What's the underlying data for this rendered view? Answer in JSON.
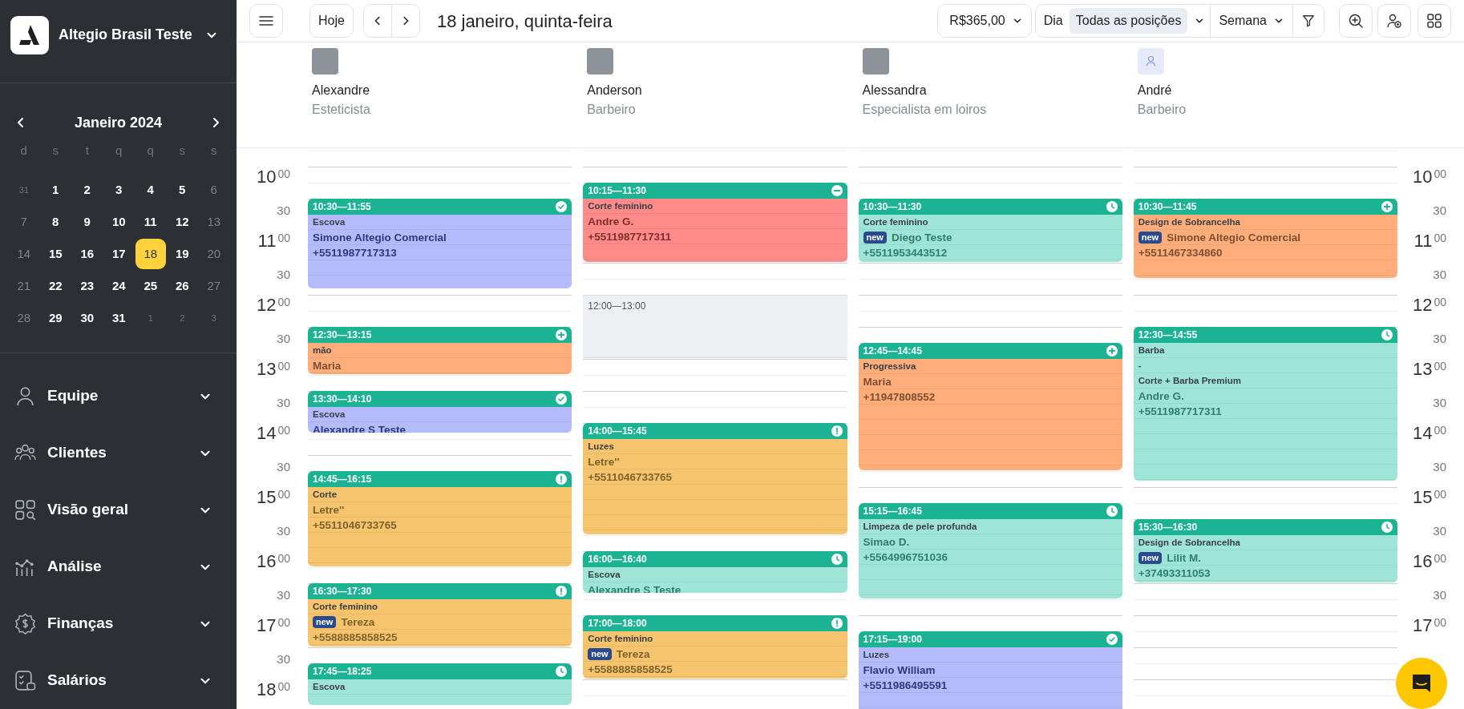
{
  "sidebar": {
    "company": "Altegio Brasil Teste",
    "calendar": {
      "month": "Janeiro 2024",
      "weekdays": [
        "d",
        "s",
        "t",
        "q",
        "q",
        "s",
        "s"
      ],
      "days": [
        {
          "label": "31",
          "kind": "outside",
          "selected": false
        },
        {
          "label": "1",
          "kind": "day",
          "selected": false
        },
        {
          "label": "2",
          "kind": "day",
          "selected": false
        },
        {
          "label": "3",
          "kind": "day",
          "selected": false
        },
        {
          "label": "4",
          "kind": "day",
          "selected": false
        },
        {
          "label": "5",
          "kind": "day",
          "selected": false
        },
        {
          "label": "6",
          "kind": "weekend",
          "selected": false
        },
        {
          "label": "7",
          "kind": "weekend",
          "selected": false
        },
        {
          "label": "8",
          "kind": "day",
          "selected": false
        },
        {
          "label": "9",
          "kind": "day",
          "selected": false
        },
        {
          "label": "10",
          "kind": "day",
          "selected": false
        },
        {
          "label": "11",
          "kind": "day",
          "selected": false
        },
        {
          "label": "12",
          "kind": "day",
          "selected": false
        },
        {
          "label": "13",
          "kind": "weekend",
          "selected": false
        },
        {
          "label": "14",
          "kind": "weekend",
          "selected": false
        },
        {
          "label": "15",
          "kind": "day",
          "selected": false
        },
        {
          "label": "16",
          "kind": "day",
          "selected": false
        },
        {
          "label": "17",
          "kind": "day",
          "selected": false
        },
        {
          "label": "18",
          "kind": "day",
          "selected": true
        },
        {
          "label": "19",
          "kind": "day",
          "selected": false
        },
        {
          "label": "20",
          "kind": "weekend",
          "selected": false
        },
        {
          "label": "21",
          "kind": "weekend",
          "selected": false
        },
        {
          "label": "22",
          "kind": "day",
          "selected": false
        },
        {
          "label": "23",
          "kind": "day",
          "selected": false
        },
        {
          "label": "24",
          "kind": "day",
          "selected": false
        },
        {
          "label": "25",
          "kind": "day",
          "selected": false
        },
        {
          "label": "26",
          "kind": "day",
          "selected": false
        },
        {
          "label": "27",
          "kind": "weekend",
          "selected": false
        },
        {
          "label": "28",
          "kind": "weekend",
          "selected": false
        },
        {
          "label": "29",
          "kind": "day",
          "selected": false
        },
        {
          "label": "30",
          "kind": "day",
          "selected": false
        },
        {
          "label": "31",
          "kind": "day",
          "selected": false
        },
        {
          "label": "1",
          "kind": "outside",
          "selected": false
        },
        {
          "label": "2",
          "kind": "outside",
          "selected": false
        },
        {
          "label": "3",
          "kind": "outside",
          "selected": false
        }
      ]
    },
    "nav_items": [
      {
        "label": "Equipe"
      },
      {
        "label": "Clientes"
      },
      {
        "label": "Visão geral"
      },
      {
        "label": "Análise"
      },
      {
        "label": "Finanças"
      },
      {
        "label": "Salários"
      }
    ]
  },
  "toolbar": {
    "today_button": "Hoje",
    "title": "18 janeiro, quinta-feira",
    "revenue": "R$365,00",
    "day_label": "Dia",
    "position_filter": "Todas as posições",
    "view_select": "Semana"
  },
  "time_axis_left": [
    {
      "hour": "10",
      "minutes": "00"
    },
    {
      "minutes": "30"
    },
    {
      "hour": "11",
      "minutes": "00"
    },
    {
      "minutes": "30"
    },
    {
      "hour": "12",
      "minutes": "00"
    },
    {
      "minutes": "30"
    },
    {
      "hour": "13",
      "minutes": "00"
    },
    {
      "minutes": "30"
    },
    {
      "hour": "14",
      "minutes": "00"
    },
    {
      "minutes": "30"
    },
    {
      "hour": "15",
      "minutes": "00"
    },
    {
      "minutes": "30"
    },
    {
      "hour": "16",
      "minutes": "00"
    },
    {
      "minutes": "30"
    },
    {
      "hour": "17",
      "minutes": "00"
    },
    {
      "minutes": "30"
    },
    {
      "hour": "18",
      "minutes": "00"
    }
  ],
  "time_axis_right": [
    {
      "hour": "10",
      "minutes": "00"
    },
    {
      "minutes": "30"
    },
    {
      "hour": "11",
      "minutes": "00"
    },
    {
      "minutes": "30"
    },
    {
      "hour": "12",
      "minutes": "00"
    },
    {
      "minutes": "30"
    },
    {
      "hour": "13",
      "minutes": "00"
    },
    {
      "minutes": "30"
    },
    {
      "hour": "14",
      "minutes": "00"
    },
    {
      "minutes": "30"
    },
    {
      "hour": "15",
      "minutes": "00"
    },
    {
      "minutes": "30"
    },
    {
      "hour": "16",
      "minutes": "00"
    },
    {
      "minutes": "30"
    },
    {
      "hour": "17",
      "minutes": "00"
    }
  ],
  "columns": [
    {
      "name": "Alexandre",
      "role": "Esteticista",
      "avatar": {
        "kind": "photo"
      },
      "events": [
        {
          "kind": "appointment",
          "time": "10:30—11:55",
          "status": {
            "kind": "confirmed"
          },
          "color": "#b3bbfb",
          "services": [
            "Escova"
          ],
          "client": "Simone Altegio Comercial",
          "phone": "+5511987717313"
        },
        {
          "kind": "appointment",
          "time": "12:30—13:15",
          "status": {
            "kind": "added"
          },
          "color": "#ffad7a",
          "services": [
            "mão"
          ],
          "client": "Maria"
        },
        {
          "kind": "appointment",
          "time": "13:30—14:10",
          "status": {
            "kind": "confirmed"
          },
          "color": "#b3bbfb",
          "services": [
            "Escova"
          ],
          "client": "Alexandre S Teste"
        },
        {
          "kind": "appointment",
          "time": "14:45—16:15",
          "status": {
            "kind": "unconfirmed"
          },
          "color": "#f5c46c",
          "services": [
            "Corte"
          ],
          "client": "Letre''",
          "phone": "+5511046733765"
        },
        {
          "kind": "appointment",
          "time": "16:30—17:30",
          "status": {
            "kind": "unconfirmed"
          },
          "color": "#f5c46c",
          "services": [
            "Corte feminino"
          ],
          "badge": "new",
          "client": "Tereza",
          "phone": "+5588885858525"
        },
        {
          "kind": "appointment",
          "time": "17:45—18:25",
          "status": {
            "kind": "waiting"
          },
          "color": "#9fe5d7",
          "services": [
            "Escova"
          ]
        }
      ]
    },
    {
      "name": "Anderson",
      "role": "Barbeiro",
      "avatar": {
        "kind": "photo"
      },
      "events": [
        {
          "kind": "appointment",
          "time": "10:15—11:30",
          "status": {
            "kind": "canceled"
          },
          "color": "#ff8a8a",
          "services": [
            "Corte feminino"
          ],
          "client": "Andre G.",
          "phone": "+5511987717311"
        },
        {
          "kind": "break",
          "time": "12:00—13:00"
        },
        {
          "kind": "appointment",
          "time": "14:00—15:45",
          "status": {
            "kind": "unconfirmed"
          },
          "color": "#f5c46c",
          "services": [
            "Luzes"
          ],
          "client": "Letre''",
          "phone": "+5511046733765"
        },
        {
          "kind": "appointment",
          "time": "16:00—16:40",
          "status": {
            "kind": "waiting"
          },
          "color": "#9fe5d7",
          "services": [
            "Escova"
          ],
          "client": "Alexandre S Teste"
        },
        {
          "kind": "appointment",
          "time": "17:00—18:00",
          "status": {
            "kind": "unconfirmed"
          },
          "color": "#f5c46c",
          "services": [
            "Corte feminino"
          ],
          "badge": "new",
          "client": "Tereza",
          "phone": "+5588885858525"
        }
      ]
    },
    {
      "name": "Alessandra",
      "role": "Especialista em loiros",
      "avatar": {
        "kind": "photo"
      },
      "events": [
        {
          "kind": "appointment",
          "time": "10:30—11:30",
          "status": {
            "kind": "waiting"
          },
          "color": "#9fe5d7",
          "services": [
            "Corte feminino"
          ],
          "badge": "new",
          "client": "Diego Teste",
          "phone": "+5511953443512"
        },
        {
          "kind": "appointment",
          "time": "12:45—14:45",
          "status": {
            "kind": "added"
          },
          "color": "#ffad7a",
          "services": [
            "Progressiva"
          ],
          "client": "Maria",
          "phone": "+11947808552"
        },
        {
          "kind": "appointment",
          "time": "15:15—16:45",
          "status": {
            "kind": "waiting"
          },
          "color": "#9fe5d7",
          "services": [
            "Limpeza de pele profunda"
          ],
          "client": "Simao D.",
          "phone": "+5564996751036"
        },
        {
          "kind": "appointment",
          "time": "17:15—19:00",
          "status": {
            "kind": "confirmed"
          },
          "color": "#b3bbfb",
          "services": [
            "Luzes"
          ],
          "client": "Flavio William",
          "phone": "+5511986495591"
        }
      ]
    },
    {
      "name": "André",
      "role": "Barbeiro",
      "avatar": {
        "kind": "default"
      },
      "events": [
        {
          "kind": "appointment",
          "time": "10:30—11:45",
          "status": {
            "kind": "added"
          },
          "color": "#ffad7a",
          "services": [
            "Design de Sobrancelha"
          ],
          "badge": "new",
          "client": "Simone Altegio Comercial",
          "phone": "+5511467334860"
        },
        {
          "kind": "appointment",
          "time": "12:30—14:55",
          "status": {
            "kind": "waiting"
          },
          "color": "#9fe5d7",
          "services": [
            "Barba",
            "-",
            "Corte + Barba Premium"
          ],
          "client": "Andre G.",
          "phone": "+5511987717311"
        },
        {
          "kind": "appointment",
          "time": "15:30—16:30",
          "status": {
            "kind": "waiting"
          },
          "color": "#9fe5d7",
          "services": [
            "Design de Sobrancelha"
          ],
          "badge": "new",
          "client": "Lilit M.",
          "phone": "+37493311053"
        }
      ]
    }
  ]
}
